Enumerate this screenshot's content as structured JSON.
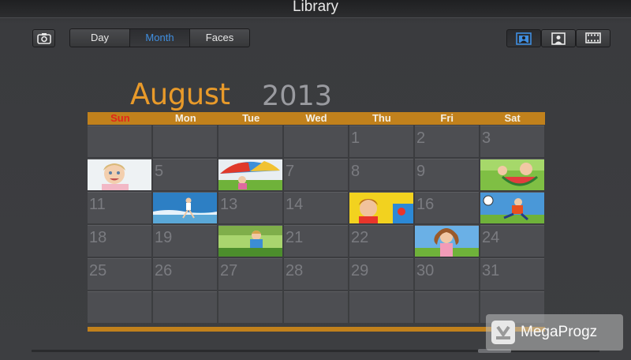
{
  "window": {
    "title": "Library"
  },
  "toolbar": {
    "camera_icon": "camera-icon",
    "tabs": [
      {
        "label": "Day",
        "active": false
      },
      {
        "label": "Month",
        "active": true
      },
      {
        "label": "Faces",
        "active": false
      }
    ],
    "view_buttons": [
      {
        "icon": "person-frame-icon",
        "active": true
      },
      {
        "icon": "portrait-icon",
        "active": false
      },
      {
        "icon": "film-strip-icon",
        "active": false
      }
    ],
    "active_color": "#3f8ee0"
  },
  "calendar": {
    "month": "August",
    "year": "2013",
    "weekdays": [
      "Sun",
      "Mon",
      "Tue",
      "Wed",
      "Thu",
      "Fri",
      "Sat"
    ],
    "accent_color": "#c1811c",
    "weeks": [
      [
        "",
        "",
        "",
        "",
        "1",
        "2",
        "3"
      ],
      [
        "",
        "5",
        "",
        "7",
        "8",
        "9",
        ""
      ],
      [
        "11",
        "",
        "13",
        "14",
        "",
        "16",
        ""
      ],
      [
        "18",
        "19",
        "",
        "21",
        "22",
        "",
        "24"
      ],
      [
        "25",
        "26",
        "27",
        "28",
        "29",
        "30",
        "31"
      ],
      [
        "",
        "",
        "",
        "",
        "",
        "",
        ""
      ]
    ],
    "photo_days": [
      {
        "day": "4",
        "icon": "child-photo-icon"
      },
      {
        "day": "6",
        "icon": "umbrella-photo-icon"
      },
      {
        "day": "10",
        "icon": "watermelon-photo-icon"
      },
      {
        "day": "12",
        "icon": "beach-photo-icon"
      },
      {
        "day": "15",
        "icon": "kids-photo-icon"
      },
      {
        "day": "17",
        "icon": "soccer-photo-icon"
      },
      {
        "day": "20",
        "icon": "grass-photo-icon"
      },
      {
        "day": "23",
        "icon": "girl-photo-icon"
      }
    ]
  },
  "watermark": {
    "text": "MegaProgz"
  }
}
